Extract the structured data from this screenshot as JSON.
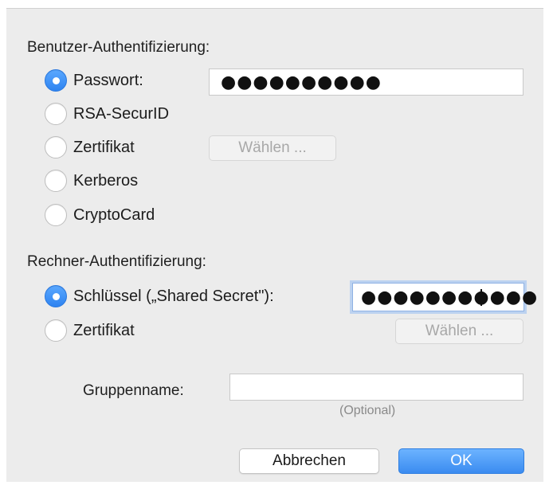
{
  "user_auth": {
    "heading": "Benutzer-Authentifizierung:",
    "options": [
      {
        "label": "Passwort:",
        "checked": true
      },
      {
        "label": "RSA-SecurID",
        "checked": false
      },
      {
        "label": "Zertifikat",
        "checked": false
      },
      {
        "label": "Kerberos",
        "checked": false
      },
      {
        "label": "CryptoCard",
        "checked": false
      }
    ],
    "password_value": "●●●●●●●●●●",
    "choose_label": "Wählen ..."
  },
  "machine_auth": {
    "heading": "Rechner-Authentifizierung:",
    "options": [
      {
        "label": "Schlüssel („Shared Secret\"):",
        "checked": true
      },
      {
        "label": "Zertifikat",
        "checked": false
      }
    ],
    "secret_value": "●●●●●●●●●●●",
    "choose_label": "Wählen ..."
  },
  "group": {
    "label": "Gruppenname:",
    "value": "",
    "hint": "(Optional)"
  },
  "buttons": {
    "cancel": "Abbrechen",
    "ok": "OK"
  },
  "colors": {
    "accent": "#3a8bf0",
    "dialog_bg": "#ececec"
  }
}
